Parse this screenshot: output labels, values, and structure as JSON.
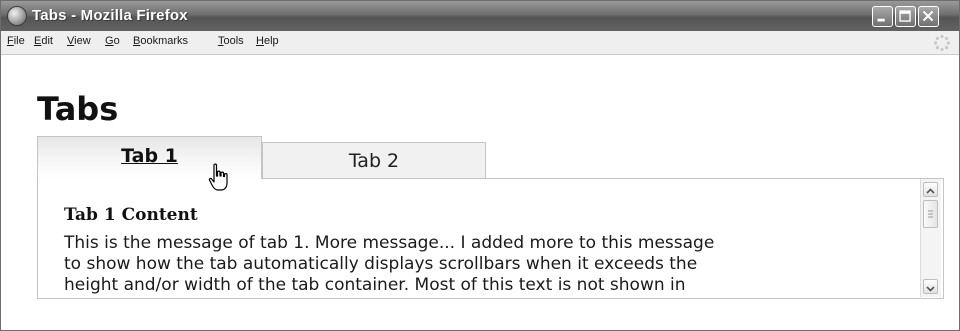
{
  "window": {
    "title": "Tabs - Mozilla Firefox"
  },
  "menubar": {
    "items": [
      {
        "key": "F",
        "rest": "ile"
      },
      {
        "key": "E",
        "rest": "dit"
      },
      {
        "key": "V",
        "rest": "iew"
      },
      {
        "key": "G",
        "rest": "o"
      },
      {
        "key": "B",
        "rest": "ookmarks"
      },
      {
        "key": "T",
        "rest": "ools"
      },
      {
        "key": "H",
        "rest": "elp"
      }
    ]
  },
  "page": {
    "title": "Tabs",
    "tabs": [
      {
        "label": "Tab 1",
        "active": true
      },
      {
        "label": "Tab 2",
        "active": false
      }
    ],
    "panel": {
      "heading": "Tab 1 Content",
      "lines": [
        "This is the message of tab 1. More message... I added more to this message",
        "to show how the tab automatically displays scrollbars when it exceeds the",
        "height and/or width of the tab container. Most of this text is not shown in"
      ]
    }
  },
  "icons": {
    "app": "firefox-icon",
    "minimize": "minimize-icon",
    "maximize": "maximize-icon",
    "close": "close-icon",
    "throbber": "throbber-icon",
    "cursor": "hand-pointer-cursor-icon"
  },
  "colors": {
    "titlebar": "#6e6e6e",
    "menubar": "#efefef",
    "tab_border": "#c4c4c4"
  }
}
